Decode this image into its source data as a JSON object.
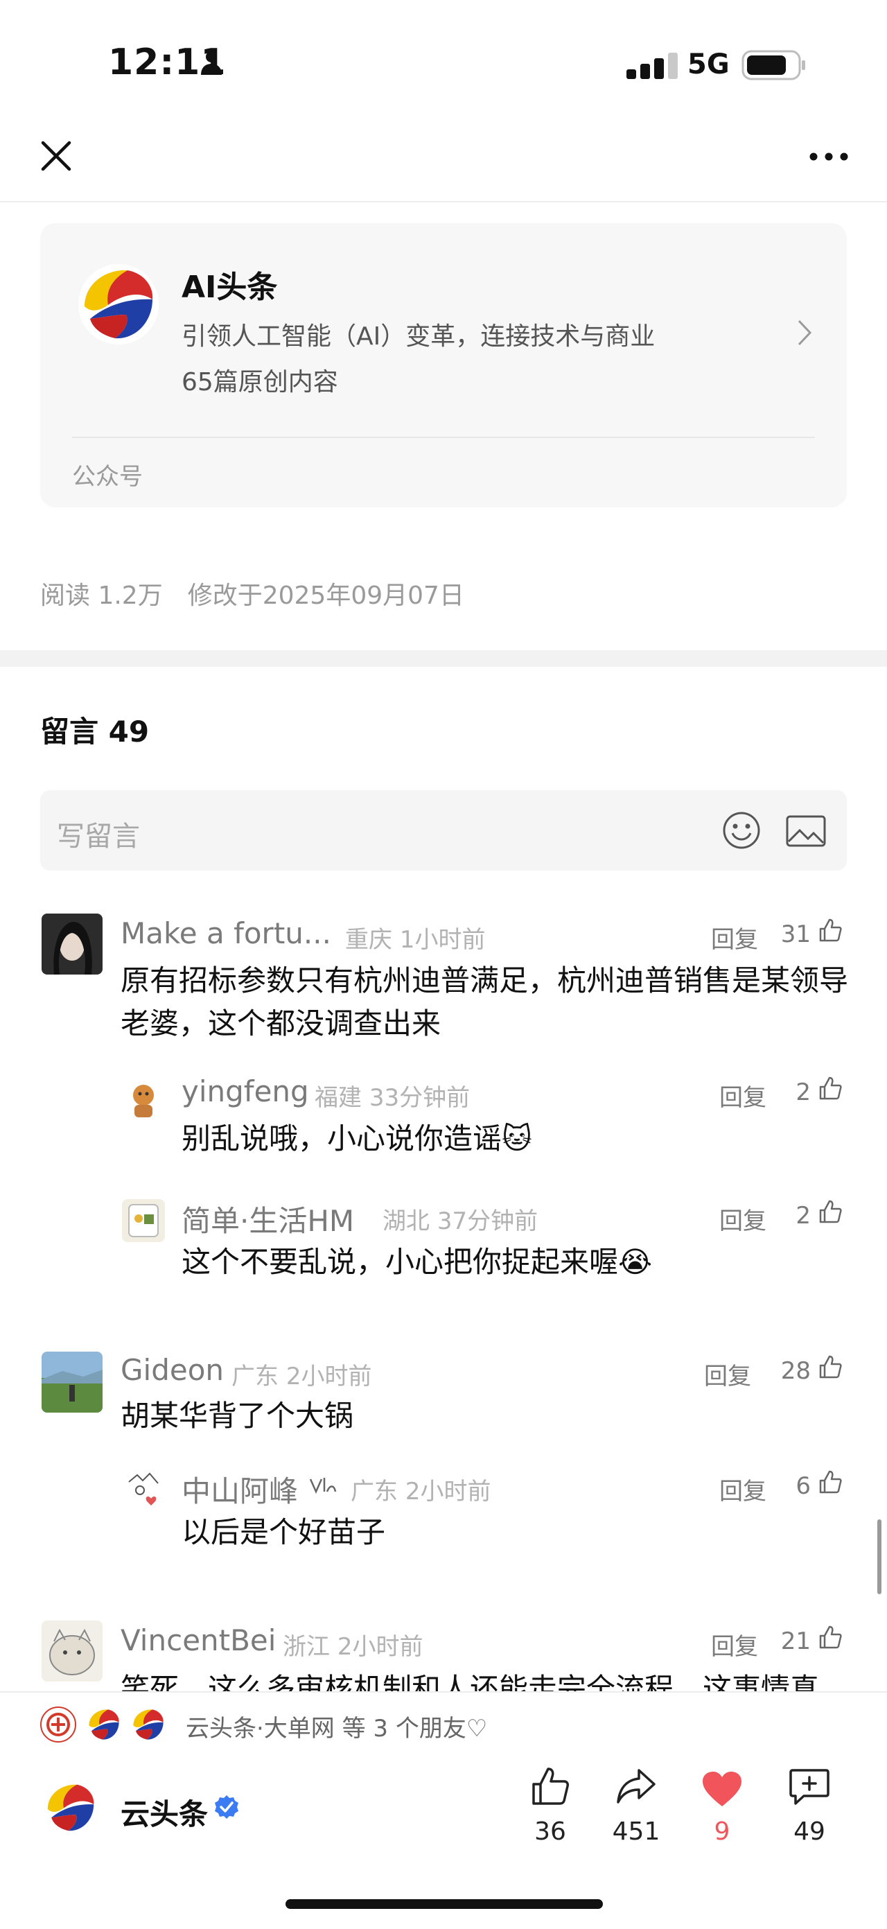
{
  "status_bar": {
    "time": "12:11",
    "network": "5G"
  },
  "account": {
    "name": "AI头条",
    "description": "引领人工智能（AI）变革，连接技术与商业",
    "original_count": "65篇原创内容",
    "type": "公众号"
  },
  "article_meta": {
    "reads": "阅读 1.2万",
    "modified": "修改于2025年09月07日"
  },
  "comments_section": {
    "title": "留言 49",
    "input_placeholder": "写留言",
    "reply_label": "回复",
    "comments": [
      {
        "name": "Make a fortu...",
        "location": "重庆",
        "time": "1小时前",
        "likes": "31",
        "text": "原有招标参数只有杭州迪普满足，杭州迪普销售是某领导老婆，这个都没调查出来",
        "replies": [
          {
            "name": "yingfeng",
            "location": "福建",
            "time": "33分钟前",
            "likes": "2",
            "text": "别乱说哦，小心说你造谣🐱"
          },
          {
            "name": "简单·生活HM",
            "location": "湖北",
            "time": "37分钟前",
            "likes": "2",
            "text": "这个不要乱说，小心把你捉起来喔😭"
          }
        ]
      },
      {
        "name": "Gideon",
        "location": "广东",
        "time": "2小时前",
        "likes": "28",
        "text": "胡某华背了个大锅",
        "replies": [
          {
            "name": "中山阿峰",
            "location": "广东",
            "time": "2小时前",
            "likes": "6",
            "text": "以后是个好苗子"
          }
        ]
      },
      {
        "name": "VincentBei",
        "location": "浙江",
        "time": "2小时前",
        "likes": "21",
        "text": "笑死，这么多审核机制和人还能走完全流程，这事情真"
      }
    ]
  },
  "bottom_bar": {
    "friends_text": "云头条·大单网 等 3 个朋友♡",
    "author_name": "云头条",
    "actions": {
      "like": "36",
      "share": "451",
      "favorite": "9",
      "comment": "49"
    }
  },
  "colors": {
    "heart": "#f2545b",
    "verified": "#3b7cf5"
  }
}
